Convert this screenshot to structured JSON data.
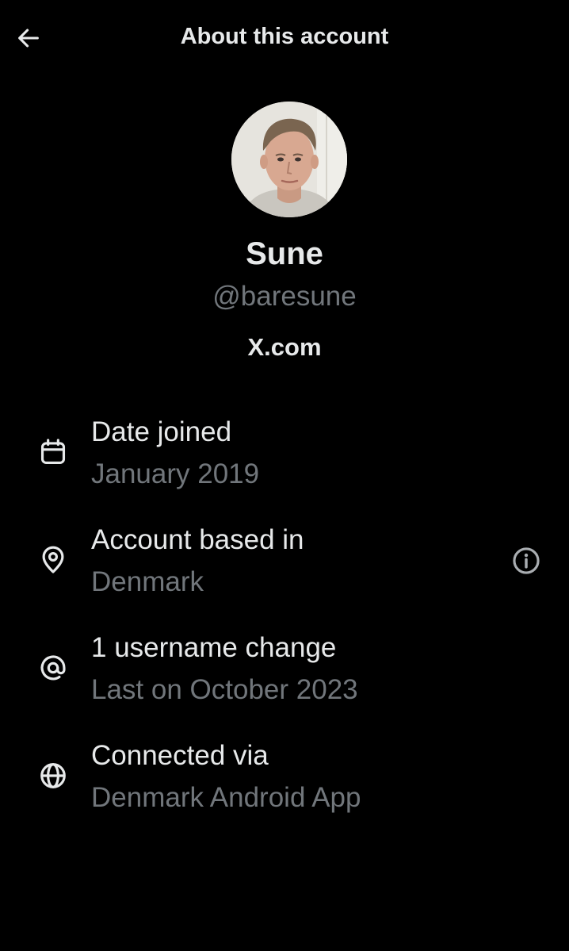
{
  "header": {
    "title": "About this account",
    "back_icon": "arrow-left-icon"
  },
  "profile": {
    "display_name": "Sune",
    "handle": "@baresune",
    "source": "X.com",
    "avatar": "avatar-photo"
  },
  "details": [
    {
      "icon": "calendar-icon",
      "label": "Date joined",
      "value": "January 2019"
    },
    {
      "icon": "location-pin-icon",
      "label": "Account based in",
      "value": "Denmark",
      "info_icon": "info-icon"
    },
    {
      "icon": "at-sign-icon",
      "label": "1 username change",
      "value": "Last on October 2023"
    },
    {
      "icon": "globe-icon",
      "label": "Connected via",
      "value": "Denmark Android App"
    }
  ],
  "colors": {
    "background": "#000000",
    "primary_text": "#e7e9ea",
    "secondary_text": "#71767b"
  }
}
